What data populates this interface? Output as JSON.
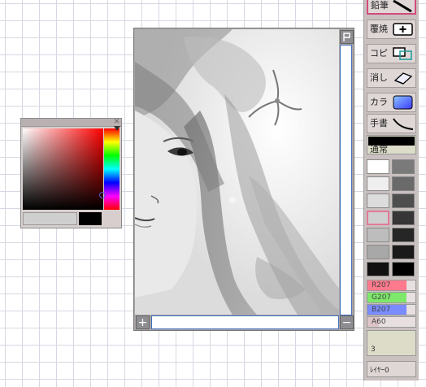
{
  "picker": {
    "close_icon": "close-icon",
    "colors": {
      "hue": "#ff0000",
      "current": "#000000"
    }
  },
  "canvas": {
    "top_button": "flag-icon",
    "zoom_in": "+",
    "zoom_out": "−"
  },
  "tools": [
    {
      "label": "鉛筆",
      "icon": "pencil-stroke-icon",
      "active": true
    },
    {
      "label": "覆焼",
      "icon": "dodge-plus-icon",
      "active": false
    },
    {
      "label": "コピ",
      "icon": "copy-rect-icon",
      "active": false
    },
    {
      "label": "消し",
      "icon": "eraser-icon",
      "active": false
    },
    {
      "label": "カラ",
      "icon": "color-gradient-icon",
      "active": false
    },
    {
      "label": "手書",
      "icon": "freehand-curve-icon",
      "active": false
    }
  ],
  "mode": {
    "label": "通常"
  },
  "swatches": [
    [
      "#ffffff",
      "#7a7a7a"
    ],
    [
      "#efefef",
      "#6a6a6a"
    ],
    [
      "#dcdcdc",
      "#4e4e4e"
    ],
    [
      "#cfcfcf",
      "#363636"
    ],
    [
      "#bdbdbd",
      "#262626"
    ],
    [
      "#a8a8a8",
      "#1a1a1a"
    ],
    [
      "#111111",
      "#000000"
    ]
  ],
  "sliders": {
    "r": {
      "label": "R207",
      "color": "#ff7a8c",
      "level": 0.81
    },
    "g": {
      "label": "G207",
      "color": "#7ee86a",
      "level": 0.81
    },
    "b": {
      "label": "B207",
      "color": "#7a8cff",
      "level": 0.81
    },
    "a": {
      "label": "A60",
      "color": "#dcc4c8",
      "level": 0.24
    }
  },
  "brush_size": {
    "value": "3"
  },
  "layer": {
    "label": "ﾚｲﾔｰ0"
  }
}
